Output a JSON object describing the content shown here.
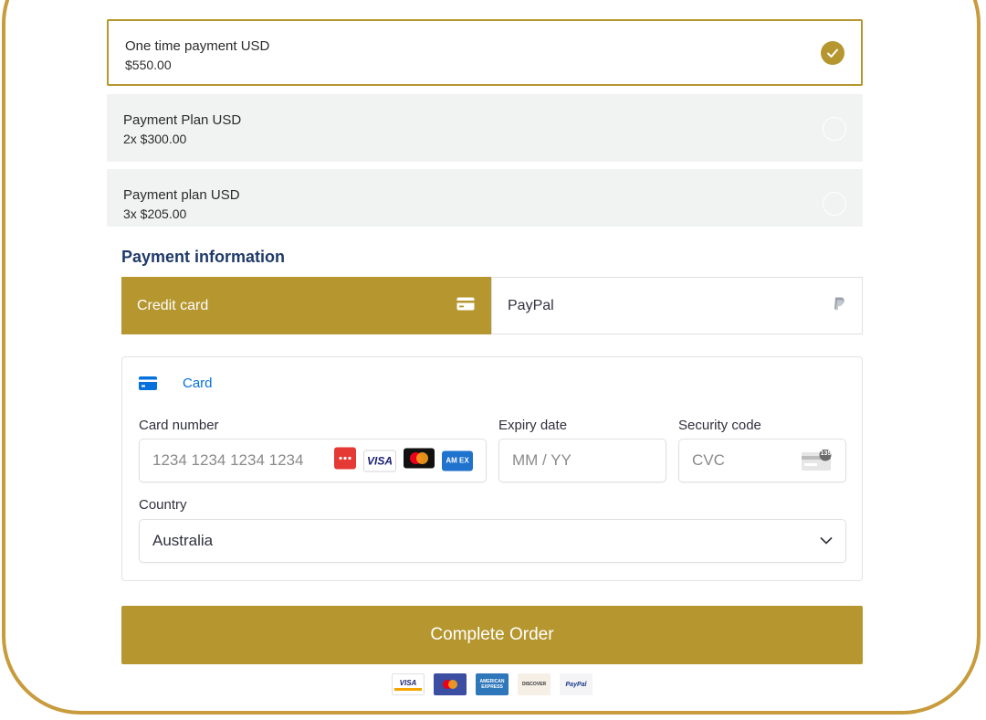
{
  "plans": [
    {
      "name": "One time payment USD",
      "price": "$550.00",
      "selected": true
    },
    {
      "name": "Payment Plan USD",
      "price": "2x $300.00",
      "selected": false
    },
    {
      "name": "Payment plan USD",
      "price": "3x $205.00",
      "selected": false
    }
  ],
  "payment_info": {
    "title": "Payment information",
    "tabs": [
      {
        "label": "Credit card",
        "active": true,
        "icon": "credit-card-icon"
      },
      {
        "label": "PayPal",
        "active": false,
        "icon": "paypal-icon"
      }
    ]
  },
  "card_form": {
    "section_label": "Card",
    "card_number": {
      "label": "Card number",
      "placeholder": "1234 1234 1234 1234"
    },
    "expiry": {
      "label": "Expiry date",
      "placeholder": "MM / YY"
    },
    "security": {
      "label": "Security code",
      "placeholder": "CVC",
      "badge": "135"
    },
    "country": {
      "label": "Country",
      "value": "Australia"
    },
    "brand_logos": {
      "visa": "VISA",
      "amex": "AM EX"
    }
  },
  "complete_button": "Complete Order",
  "footer_logos": {
    "visa": "VISA",
    "amex": "AMERICAN EXPRESS",
    "discover": "DISCOVER",
    "paypal": "PayPal"
  },
  "colors": {
    "accent": "#b5962f",
    "title": "#1f3a6a",
    "link": "#0570de",
    "frame": "#c89b3c"
  }
}
